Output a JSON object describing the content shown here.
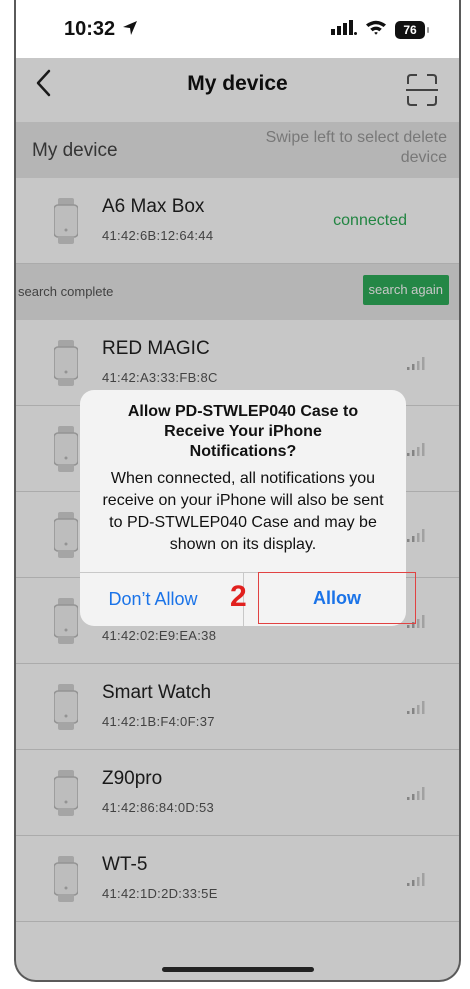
{
  "status": {
    "time": "10:32",
    "battery": "76"
  },
  "nav": {
    "title": "My device"
  },
  "my_device": {
    "label": "My device",
    "hint": "Swipe left to select delete device",
    "item": {
      "name": "A6 Max Box",
      "mac": "41:42:6B:12:64:44",
      "status": "connected"
    }
  },
  "search": {
    "label": "search complete",
    "button": "search again"
  },
  "devices": [
    {
      "name": "RED MAGIC",
      "mac": "41:42:A3:33:FB:8C"
    },
    {
      "name": "",
      "mac": ""
    },
    {
      "name": "",
      "mac": ""
    },
    {
      "name": "",
      "mac": "41:42:02:E9:EA:38"
    },
    {
      "name": "Smart Watch",
      "mac": "41:42:1B:F4:0F:37"
    },
    {
      "name": "Z90pro",
      "mac": "41:42:86:84:0D:53"
    },
    {
      "name": "WT-5",
      "mac": "41:42:1D:2D:33:5E"
    }
  ],
  "dialog": {
    "title": "Allow PD-STWLEP040 Case to Receive Your iPhone Notifications?",
    "body": "When connected, all notifications you receive on your iPhone will also be sent to PD-STWLEP040 Case and may be shown on its display.",
    "dont_allow": "Don’t Allow",
    "allow": "Allow",
    "marker": "2"
  },
  "colors": {
    "accent_green": "#2fad5a",
    "link_blue": "#1a73e8",
    "marker_red": "#e1201e"
  }
}
